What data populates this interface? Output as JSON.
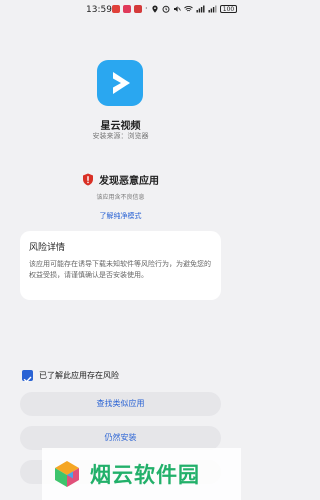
{
  "status_bar": {
    "time": "13:59",
    "battery": "100",
    "notification_colors": [
      "#e0403a",
      "#e03a5a",
      "#d43a3a"
    ]
  },
  "app": {
    "name": "星云视频",
    "source": "安装来源：浏览器",
    "icon_color": "#2aa7f0"
  },
  "warning": {
    "title": "发现恶意应用",
    "subtitle": "该应用含不良信息",
    "link": "了解纯净模式"
  },
  "risk": {
    "title": "风险详情",
    "text": "该应用可能存在诱导下载未知软件等风险行为，为避免您的权益受损，请谨慎确认是否安装使用。"
  },
  "ack": {
    "label": "已了解此应用存在风险",
    "checked": true
  },
  "buttons": {
    "find_similar": "查找类似应用",
    "install_anyway": "仍然安装"
  },
  "watermark": {
    "text": "烟云软件园"
  },
  "colors": {
    "accent": "#2a63d4",
    "danger": "#d93025",
    "watermark": "#22b06a"
  }
}
